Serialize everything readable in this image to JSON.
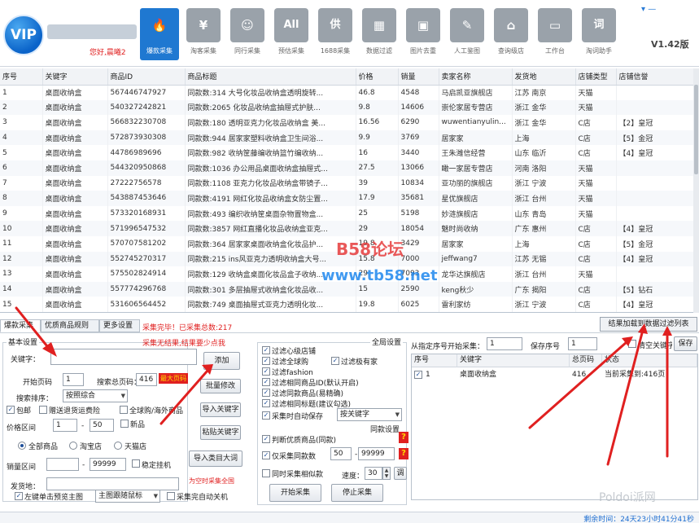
{
  "header": {
    "logo_text": "VIP",
    "greeting": "您好,晨曦2",
    "version": "V1.42版",
    "tools": [
      {
        "label": "爆款采集",
        "icon": "flame",
        "glyph": "🔥",
        "active": true
      },
      {
        "label": "淘客采集",
        "icon": "yen",
        "glyph": "¥",
        "active": false
      },
      {
        "label": "同行采集",
        "icon": "person",
        "glyph": "☺",
        "active": false
      },
      {
        "label": "预估采集",
        "icon": "all",
        "glyph": "All",
        "active": false
      },
      {
        "label": "1688采集",
        "icon": "supply",
        "glyph": "供",
        "active": false
      },
      {
        "label": "数据过滤",
        "icon": "filter",
        "glyph": "▦",
        "active": false
      },
      {
        "label": "图片去重",
        "icon": "image",
        "glyph": "▣",
        "active": false
      },
      {
        "label": "人工鉴图",
        "icon": "sweep",
        "glyph": "✎",
        "active": false
      },
      {
        "label": "查询级店",
        "icon": "shop",
        "glyph": "⌂",
        "active": false
      },
      {
        "label": "工作台",
        "icon": "monitor",
        "glyph": "▭",
        "active": false
      },
      {
        "label": "淘词助手",
        "icon": "word",
        "glyph": "词",
        "active": false
      }
    ]
  },
  "grid": {
    "columns": [
      "序号",
      "关键字",
      "商品ID",
      "商品标题",
      "价格",
      "销量",
      "卖家名称",
      "发货地",
      "店铺类型",
      "店铺信誉"
    ],
    "rows": [
      [
        "1",
        "桌面收纳盒",
        "567446747927",
        "同款数:314 大号化妆品收纳盒透明旋转...",
        "46.8",
        "4548",
        "马启凯亚旗舰店",
        "江苏 南京",
        "天猫",
        ""
      ],
      [
        "2",
        "桌面收纳盒",
        "540327242821",
        "同款数:2065 化妆品收纳盒抽屉式护肤...",
        "9.8",
        "14606",
        "崇伦家居专营店",
        "浙江 金华",
        "天猫",
        ""
      ],
      [
        "3",
        "桌面收纳盒",
        "566832230708",
        "同款数:180 透明亚克力化妆品收纳盒 美...",
        "16.56",
        "6290",
        "wuwentianyulin...",
        "浙江 金华",
        "C店",
        "【2】皇冠"
      ],
      [
        "4",
        "桌面收纳盒",
        "572873930308",
        "同款数:944 居家家塑料收纳盒卫生间浴...",
        "9.9",
        "3769",
        "居家家",
        "上海",
        "C店",
        "【5】金冠"
      ],
      [
        "5",
        "桌面收纳盒",
        "44786989696",
        "同款数:982 收纳筐藤编收纳篮竹编收纳...",
        "16",
        "3440",
        "王朱潍信经营",
        "山东 临沂",
        "C店",
        "【4】皇冠"
      ],
      [
        "6",
        "桌面收纳盒",
        "544320950868",
        "同款数:1036 办公用品桌面收纳盒抽屉式...",
        "27.5",
        "13066",
        "瞰一家居专营店",
        "河南 洛阳",
        "天猫",
        ""
      ],
      [
        "7",
        "桌面收纳盒",
        "27222756578",
        "同款数:1108 亚克力化妆品收纳盒带镜子...",
        "39",
        "10834",
        "亚功丽的旗舰店",
        "浙江 宁波",
        "天猫",
        ""
      ],
      [
        "8",
        "桌面收纳盒",
        "543887453646",
        "同款数:4191 网红化妆品收纳盒女防尘置...",
        "17.9",
        "35681",
        "星优旗舰店",
        "浙江 台州",
        "天猫",
        ""
      ],
      [
        "9",
        "桌面收纳盒",
        "573320168931",
        "同款数:493 编织收纳筐桌面杂物置物盒...",
        "25",
        "5198",
        "妙涟旗舰店",
        "山东 青岛",
        "天猫",
        ""
      ],
      [
        "10",
        "桌面收纳盒",
        "571996547532",
        "同款数:3857 网红直播化妆品收纳盒亚克...",
        "29",
        "18054",
        "魅时尚收纳",
        "广东 惠州",
        "C店",
        "【4】皇冠"
      ],
      [
        "11",
        "桌面收纳盒",
        "570707581202",
        "同款数:364 居家家桌面收纳盒化妆品护...",
        "19.8",
        "3429",
        "居家家",
        "上海",
        "C店",
        "【5】金冠"
      ],
      [
        "12",
        "桌面收纳盒",
        "552745270317",
        "同款数:215 ins风亚克力透明收纳盒大号...",
        "15.8",
        "7000",
        "jeffwang7",
        "江苏 无锡",
        "C店",
        "【4】皇冠"
      ],
      [
        "13",
        "桌面收纳盒",
        "575502824914",
        "同款数:129 收纳盒桌面化妆品盒子收纳...",
        "29",
        "7093",
        "龙华达旗舰店",
        "浙江 台州",
        "天猫",
        ""
      ],
      [
        "14",
        "桌面收纳盒",
        "557774296768",
        "同款数:301 多层抽屉式收纳盒化妆品收...",
        "15",
        "2590",
        "keng秋少",
        "广东 揭阳",
        "C店",
        "【5】钻石"
      ],
      [
        "15",
        "桌面收纳盒",
        "531606564452",
        "同款数:749 桌面抽屉式亚克力透明化妆...",
        "19.8",
        "6025",
        "雷利家纺",
        "浙江 宁波",
        "C店",
        "【4】皇冠"
      ]
    ]
  },
  "tabs": {
    "items": [
      "爆款采集",
      "优质商品规则",
      "更多设置"
    ],
    "status": "采集完毕！已采集总数:217",
    "transfer_button": "结果加载到数据过滤列表"
  },
  "left_panel": {
    "group_title": "基本设置",
    "hint": "采集无结果,结果要少点我",
    "keyword_label": "关键字：",
    "keyword_value": "",
    "add_button": "添加",
    "start_page_label": "开始页码",
    "start_page_value": "1",
    "total_pages_label": "搜索总页码：",
    "total_pages_value": "416",
    "max_pages_badge": "最大页码",
    "sort_label": "搜索排序：",
    "sort_value": "按照综合",
    "batch_button": "批量修改",
    "opt_free_shipping": "包邮",
    "opt_return_insurance": "赠送退货运费险",
    "opt_global": "全球购/海外商品",
    "opt_new": "新品",
    "price_label": "价格区间",
    "price_min": "1",
    "price_sep": "-",
    "price_max": "50",
    "import_kw_button": "导入关键字",
    "radio_all": "全部商品",
    "radio_taobao": "淘宝店",
    "radio_tmall": "天猫店",
    "paste_kw_button": "粘贴关键字",
    "sales_label": "销量区间",
    "sales_min": "",
    "sales_sep": "-",
    "sales_max": "99999",
    "hide_label": "稳定挂机",
    "import_category_button": "导入类目大词",
    "empty_hint": "为空时采集全国",
    "ship_from_label": "发货地：",
    "ship_from_value": "",
    "left_click_label": "左键单击预览主图",
    "preview_select": "主图跟随鼠标",
    "auto_shutdown_label": "采集完自动关机"
  },
  "middle_panel": {
    "global_settings": "全局设置",
    "f_heart": "过滤心级店铺",
    "f_diamond": "过滤全球购",
    "f_blacklist": "过滤极有家",
    "f_fashion": "过滤fashion",
    "f_same_id": "过滤相同商品ID(默认开启)",
    "f_same_count": "过滤同款商品(易精确)",
    "f_same_title": "过滤相同标题(建议勾选)",
    "auto_save_label": "采集时自动保存",
    "auto_save_select": "按关键字",
    "same_settings": "同款设置",
    "judge_label": "判断优质商品(同款)",
    "only_same_label": "仅采集同款数",
    "same_min": "50",
    "same_sep": "-",
    "same_max": "99999",
    "same_time_label": "同时采集相似款",
    "speed_label": "速度：",
    "speed_value": "30",
    "speed_button": "调",
    "start_button": "开始采集",
    "stop_button": "停止采集"
  },
  "right_panel": {
    "from_label": "从指定序号开始采集：",
    "from_value": "1",
    "save_no_label": "保存序号",
    "save_no_value": "1",
    "clear_label": "清空关键字",
    "save_button": "保存",
    "columns": [
      "序号",
      "关键字",
      "总页码",
      "状态"
    ],
    "row": {
      "no": "1",
      "keyword": "桌面收纳盒",
      "pages": "416",
      "status": "当前采集到:416页"
    }
  },
  "footer": {
    "remaining": "剩余时间：24天23小时41分41秒"
  },
  "watermark": {
    "line1": "B58论坛",
    "line2": "www.tb58.net",
    "line3": "Poldoi派网"
  }
}
